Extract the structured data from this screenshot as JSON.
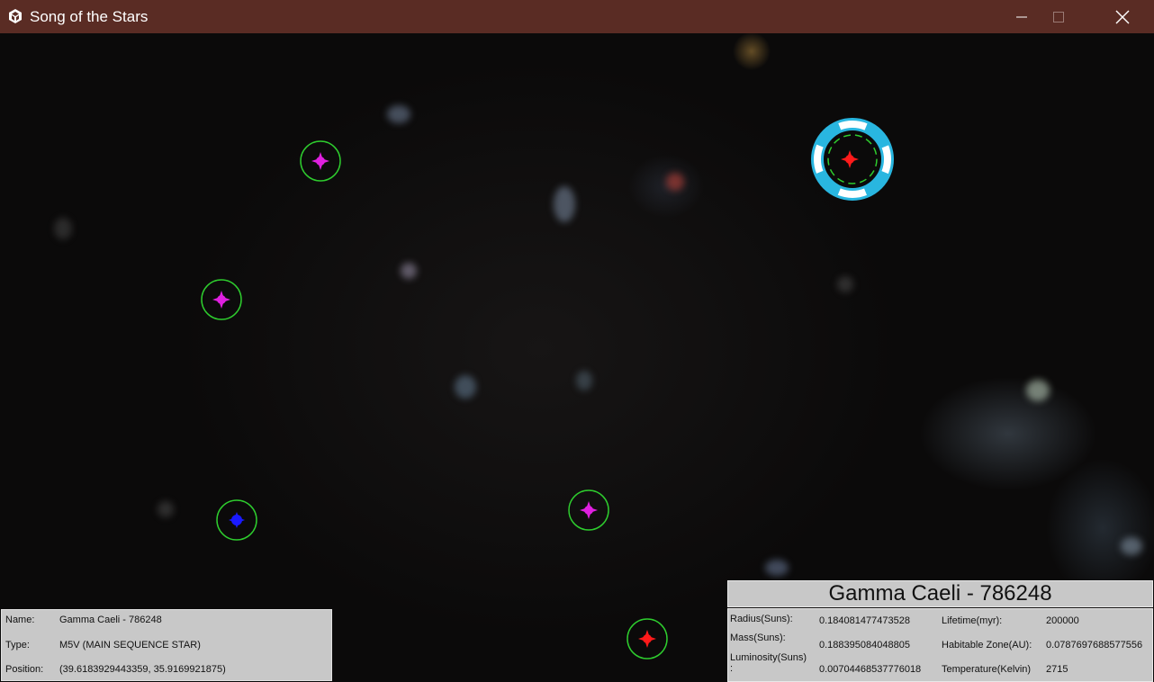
{
  "window": {
    "title": "Song of the Stars"
  },
  "icons": {
    "app": "unity-logo-icon",
    "minimize": "minimize-icon",
    "maximize": "maximize-icon",
    "close": "close-icon"
  },
  "map": {
    "stars": [
      {
        "color": "#e020e0",
        "selected": false
      },
      {
        "color": "#e020e0",
        "selected": false
      },
      {
        "color": "#1a1aff",
        "selected": false
      },
      {
        "color": "#e020e0",
        "selected": false
      },
      {
        "color": "#ff1a1a",
        "selected": false
      },
      {
        "color": "#ff1a1a",
        "selected": true
      }
    ],
    "ring_color": "#2ecc2e",
    "selector_colors": [
      "#29b6e0",
      "#ffffff"
    ]
  },
  "info": {
    "name_label": "Name:",
    "name_value": "Gamma Caeli - 786248",
    "type_label": "Type:",
    "type_value": "M5V (MAIN SEQUENCE STAR)",
    "position_label": "Position:",
    "position_value": "(39.6183929443359, 35.9169921875)"
  },
  "details": {
    "title": "Gamma Caeli - 786248",
    "radius_label": "Radius(Suns):",
    "radius_value": "0.184081477473528",
    "mass_label": "Mass(Suns):",
    "mass_value": "0.188395084048805",
    "luminosity_label": "Luminosity(Suns)",
    "luminosity_colon": ":",
    "luminosity_value": "0.00704468537776018",
    "lifetime_label": "Lifetime(myr):",
    "lifetime_value": "200000",
    "habitable_label": "Habitable Zone(AU):",
    "habitable_value": "0.0787697688577556",
    "temperature_label": "Temperature(Kelvin)",
    "temperature_value": "2715"
  }
}
